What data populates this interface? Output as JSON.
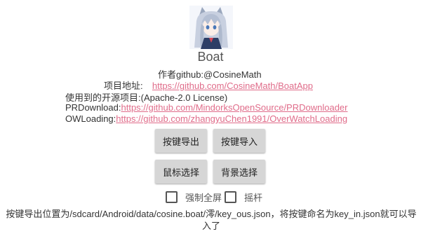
{
  "app": {
    "title": "Boat"
  },
  "info": {
    "author": "作者github:@CosineMath",
    "project_label": "项目地址:",
    "project_url": "https://github.com/CosineMath/BoatApp",
    "opensource_label": "使用到的开源项目:(Apache-2.0 License)",
    "prdownload_label": "PRDownload:",
    "prdownload_url": "https://github.com/MindorksOpenSource/PRDownloader",
    "owloading_label": "OWLoading:",
    "owloading_url": "https://github.com/zhangyuChen1991/OverWatchLoading"
  },
  "buttons": {
    "export_keys": "按键导出",
    "import_keys": "按键导入",
    "select_mouse": "鼠标选择",
    "select_background": "背景选择"
  },
  "options": {
    "force_fullscreen": "强制全屏",
    "force_fullscreen_checked": false,
    "joystick": "摇杆",
    "joystick_checked": false
  },
  "footer": {
    "note": "按键导出位置为/sdcard/Android/data/cosine.boat/澪/key_ous.json，将按键命名为key_in.json就可以导入了"
  },
  "colors": {
    "link": "#e06c8a",
    "button_bg": "#d6d6d6"
  },
  "icons": {
    "avatar": "anime-girl-avatar"
  }
}
